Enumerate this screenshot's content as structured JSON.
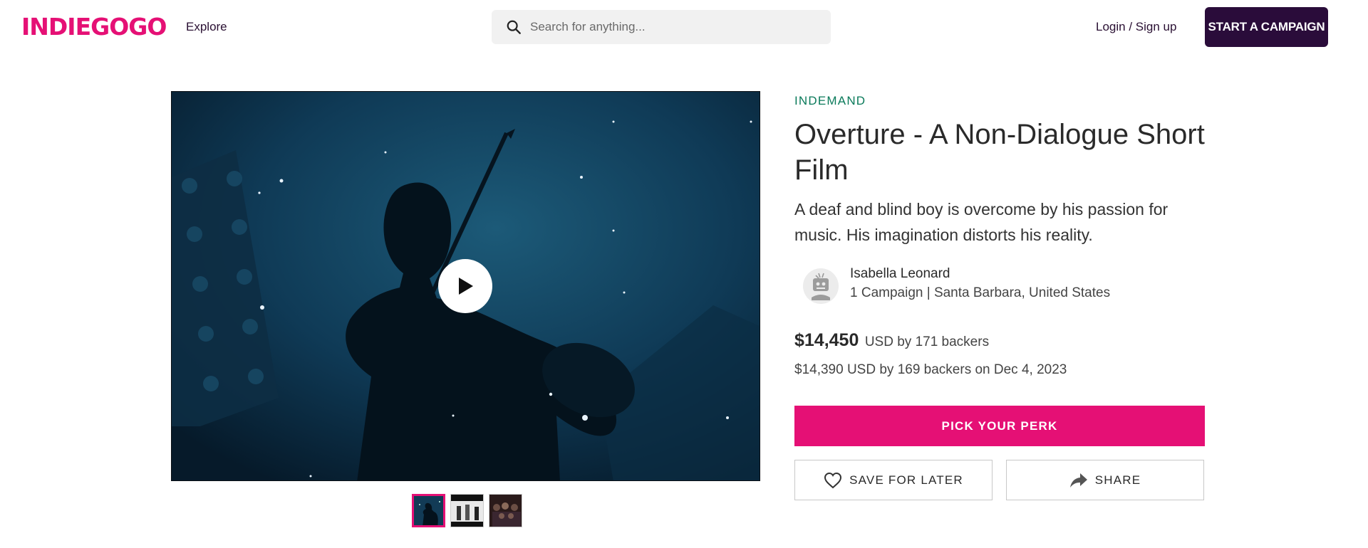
{
  "header": {
    "logo": "INDIEGOGO",
    "nav_explore": "Explore",
    "search_placeholder": "Search for anything...",
    "login_label": "Login / Sign up",
    "start_campaign_label": "START A CAMPAIGN"
  },
  "campaign": {
    "tag": "INDEMAND",
    "title": "Overture - A Non-Dialogue Short Film",
    "subtitle": "A deaf and blind boy is overcome by his passion for music. His imagination distorts his reality.",
    "owner": {
      "name": "Isabella Leonard",
      "meta": "1 Campaign | Santa Barbara, United States"
    },
    "funding": {
      "amount": "$14,450",
      "currency_backers": "USD by 171 backers",
      "previous": "$14,390 USD by 169 backers on Dec 4, 2023"
    },
    "pick_perk_label": "PICK YOUR PERK",
    "save_label": "SAVE FOR LATER",
    "share_label": "SHARE"
  },
  "media": {
    "thumbnails": [
      "thumbnail-1",
      "thumbnail-2",
      "thumbnail-3"
    ],
    "active_thumbnail": 0
  },
  "colors": {
    "brand": "#e51075",
    "dark_purple": "#2a0c3a",
    "tag_green": "#0a7a5a"
  },
  "icons": {
    "search": "search-icon",
    "play": "play-icon",
    "heart": "heart-icon",
    "share": "share-icon",
    "avatar": "robot-avatar-icon"
  }
}
